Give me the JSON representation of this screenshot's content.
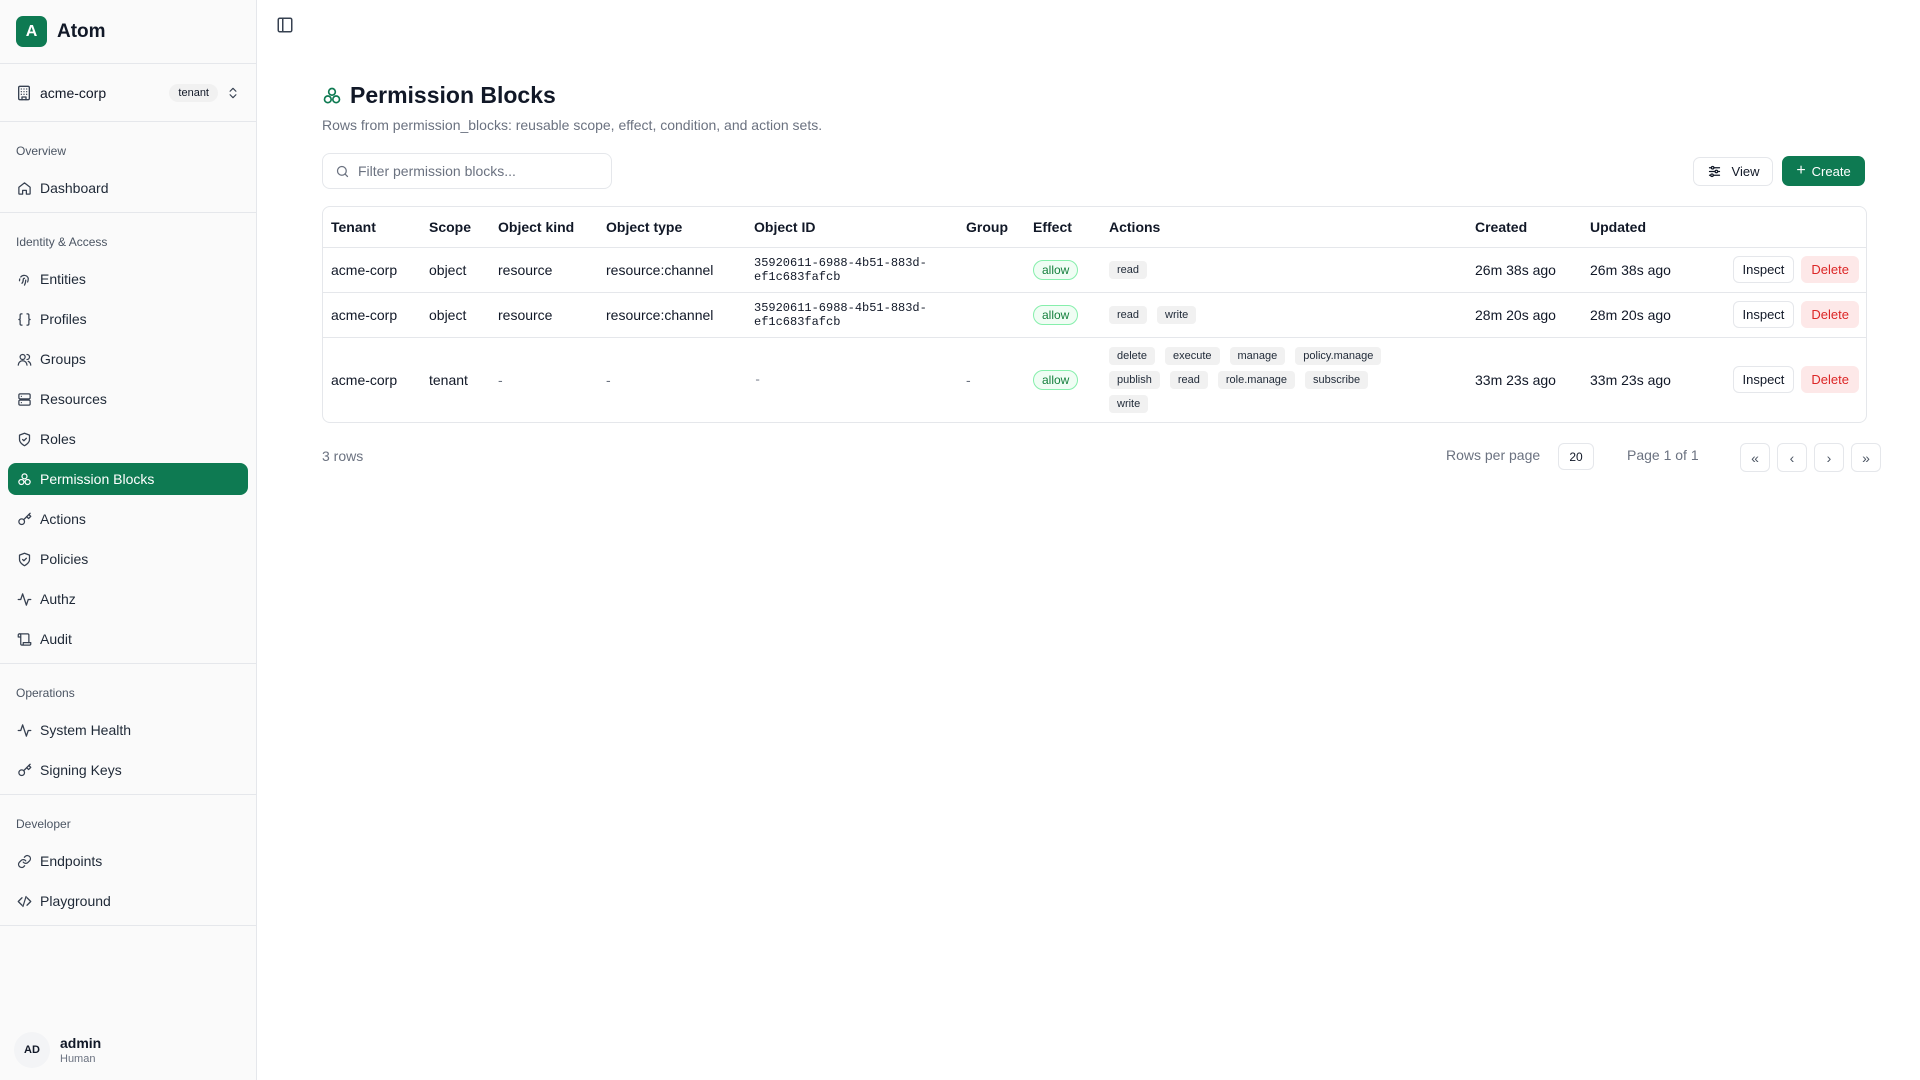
{
  "app": {
    "logo_letter": "A",
    "name": "Atom"
  },
  "tenant": {
    "name": "acme-corp",
    "badge": "tenant"
  },
  "sidebar": {
    "sections": [
      {
        "title": "Overview",
        "items": [
          {
            "label": "Dashboard",
            "icon": "home-icon"
          }
        ]
      },
      {
        "title": "Identity & Access",
        "items": [
          {
            "label": "Entities",
            "icon": "fingerprint-icon"
          },
          {
            "label": "Profiles",
            "icon": "braces-icon"
          },
          {
            "label": "Groups",
            "icon": "users-icon"
          },
          {
            "label": "Resources",
            "icon": "server-icon"
          },
          {
            "label": "Roles",
            "icon": "shield-icon"
          },
          {
            "label": "Permission Blocks",
            "icon": "blocks-icon",
            "active": true
          },
          {
            "label": "Actions",
            "icon": "key-icon"
          },
          {
            "label": "Policies",
            "icon": "shield-icon"
          },
          {
            "label": "Authz",
            "icon": "activity-icon"
          },
          {
            "label": "Audit",
            "icon": "scroll-icon"
          }
        ]
      },
      {
        "title": "Operations",
        "items": [
          {
            "label": "System Health",
            "icon": "activity-icon"
          },
          {
            "label": "Signing Keys",
            "icon": "key-icon"
          }
        ]
      },
      {
        "title": "Developer",
        "items": [
          {
            "label": "Endpoints",
            "icon": "link-icon"
          },
          {
            "label": "Playground",
            "icon": "code-icon"
          }
        ]
      }
    ]
  },
  "user": {
    "initials": "AD",
    "name": "admin",
    "role": "Human"
  },
  "page": {
    "title": "Permission Blocks",
    "subtitle": "Rows from permission_blocks: reusable scope, effect, condition, and action sets."
  },
  "toolbar": {
    "search_placeholder": "Filter permission blocks...",
    "view_label": "View",
    "create_label": "Create"
  },
  "table": {
    "columns": [
      "Tenant",
      "Scope",
      "Object kind",
      "Object type",
      "Object ID",
      "Group",
      "Effect",
      "Actions",
      "Created",
      "Updated"
    ],
    "rows": [
      {
        "tenant": "acme-corp",
        "scope": "object",
        "object_kind": "resource",
        "object_type": "resource:channel",
        "object_id": "35920611-6988-4b51-883d-ef1c683fafcb",
        "group": "",
        "effect": "allow",
        "actions": [
          "read"
        ],
        "created": "26m 38s ago",
        "updated": "26m 38s ago"
      },
      {
        "tenant": "acme-corp",
        "scope": "object",
        "object_kind": "resource",
        "object_type": "resource:channel",
        "object_id": "35920611-6988-4b51-883d-ef1c683fafcb",
        "group": "",
        "effect": "allow",
        "actions": [
          "read",
          "write"
        ],
        "created": "28m 20s ago",
        "updated": "28m 20s ago"
      },
      {
        "tenant": "acme-corp",
        "scope": "tenant",
        "object_kind": "-",
        "object_type": "-",
        "object_id": "-",
        "group": "-",
        "effect": "allow",
        "actions": [
          "delete",
          "execute",
          "manage",
          "policy.manage",
          "publish",
          "read",
          "role.manage",
          "subscribe",
          "write"
        ],
        "created": "33m 23s ago",
        "updated": "33m 23s ago"
      }
    ],
    "inspect_label": "Inspect",
    "delete_label": "Delete"
  },
  "footer": {
    "row_count": "3 rows",
    "rows_per_page_label": "Rows per page",
    "rows_per_page_value": "20",
    "page_info": "Page 1 of 1"
  },
  "colors": {
    "accent": "#0e7a52",
    "danger": "#dc2626",
    "success": "#15803d"
  }
}
